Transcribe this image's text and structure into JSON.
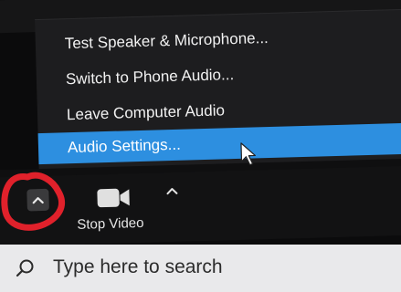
{
  "menu": {
    "items": [
      {
        "label": "Test Speaker & Microphone...",
        "selected": false
      },
      {
        "label": "Switch to Phone Audio...",
        "selected": false
      },
      {
        "label": "Leave Computer Audio",
        "selected": false
      },
      {
        "label": "Audio Settings...",
        "selected": true
      }
    ]
  },
  "toolbar": {
    "stop_video_label": "Stop Video",
    "audio_options_icon": "chevron-up-icon",
    "video_icon": "video-camera-icon",
    "video_options_icon": "chevron-up-icon"
  },
  "taskbar": {
    "search_placeholder": "Type here to search",
    "search_icon": "search-icon"
  },
  "colors": {
    "menu_bg": "#1d1d1f",
    "selected_bg": "#2d8fe0",
    "annotation": "#e0212b",
    "taskbar_bg": "#e9e9eb"
  }
}
